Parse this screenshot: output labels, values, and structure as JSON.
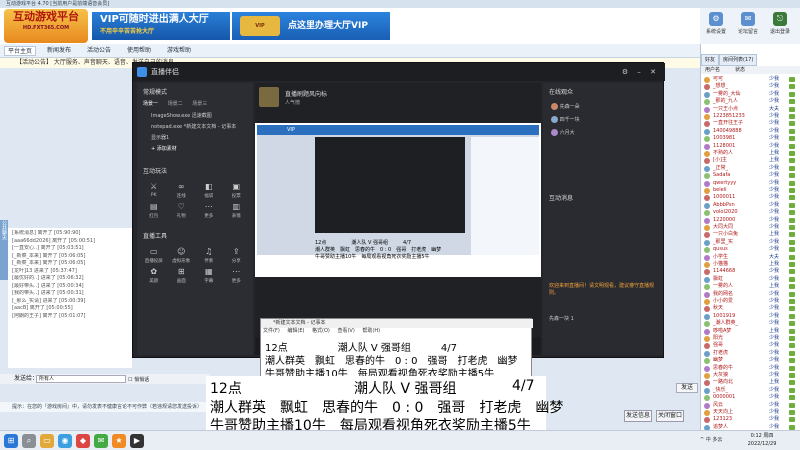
{
  "titlebar": {
    "text": "互动游戏平台 4.70 [当前用户是前端语音会员]"
  },
  "logo": {
    "main": "互动游戏平台",
    "sub": "HD.FXT365.COM"
  },
  "ads": [
    {
      "title": "VIP可随时进出满人大厅",
      "sub": "不用辛辛苦苦抢大厅"
    },
    {
      "title": "点这里办理大厅VIP"
    }
  ],
  "navbar": {
    "items": [
      "平台主页",
      "新闻发布",
      "活动公告",
      "使用帮助",
      "游戏帮助"
    ]
  },
  "right_toolbar": {
    "items": [
      {
        "label": "系统设置",
        "icon": "gear-icon"
      },
      {
        "label": "论坛留言",
        "icon": "chat-icon"
      },
      {
        "label": "退出登录",
        "icon": "logout-icon"
      }
    ]
  },
  "notice": {
    "text": "【活动公告】 大厅服务、声音聊天、语音、发送自己的消息..."
  },
  "chatlog": [
    "[系统消息] 离开了 [05:90:90]",
    "[aaa66dd2026] 离开了 [05:00:51]",
    "[一直安心..] 离开了 [05:03:51]",
    "[_新菜_本来] 离开了 [05:06:05]",
    "[_新菜_本来] 离开了 [05:06:05]",
    "[龙叶]13 进来了 [05:37:47]",
    "[最优好的..] 进来了 [05:06:32]",
    "[最好带头..] 进来了 [05:00:34]",
    "[我的带头..] 进来了 [05:00:31]",
    "[_那么_实请] 进来了 [05:00:39]",
    "[aacB] 离开了 [05:00:55]",
    "[阿朗的王子] 离开了 [05:01:07]"
  ],
  "input": {
    "label": "发送给：",
    "value": "所有人",
    "checkbox": "悄悄话"
  },
  "bottom_tip": "提示：在您的『游戏房间』中，请勿发表不健康言论不可作弊（若违规请您发送投诉）",
  "buttons": {
    "send": "发送",
    "confirm": "发送信息",
    "close": "关闭窗口"
  },
  "obs": {
    "title": "直播伴侣",
    "scene_header": "常规模式",
    "scene_tabs": [
      "场景一",
      "场景二",
      "场景三"
    ],
    "sources": [
      "ImageShow.exe 迅速截图",
      "notepad.exe *新建文本文档 - 记事本",
      "显示器1"
    ],
    "add_source": "+ 添加素材",
    "interact_header": "互动玩法",
    "interact_tools": [
      "PK",
      "连线",
      "福袋",
      "投票",
      "红包",
      "礼物",
      "更多",
      "表情"
    ],
    "live_tools_header": "直播工具",
    "live_tools": [
      "直播投屏",
      "虚拟形象",
      "伴奏",
      "分享",
      "美颜",
      "画面",
      "字幕",
      "更多"
    ],
    "stream_name": "直播刷题风向标",
    "viewers_label": "人气榜",
    "audience_header": "在线观众",
    "audience": [
      "先森一朵",
      "四千一块",
      "六月大"
    ],
    "comments_header": "互动消息",
    "chat_tip": "欢迎来到直播间！请文明观看，建议遵守直播规则。",
    "gift_item": "先森一块 1"
  },
  "preview": {
    "line1": "12点　　　　　潮人队 V 强哥组　　　4/7",
    "line2": "潮人群英　飘虹　思春的牛　0 : 0　强哥　打老虎　幽梦",
    "line3": "牛哥赞助主播10牛　每局观看视角死衣奖励主播5牛"
  },
  "notepad": {
    "title": "*新建文本文档 - 记事本",
    "menu": [
      "文件(F)",
      "编辑(E)",
      "格式(O)",
      "查看(V)",
      "帮助(H)"
    ],
    "line1": "12点　　　　　潮人队 V 强哥组　　　4/7",
    "line2": "潮人群英　飘虹　思春的牛　0 : 0　强哥　打老虎　幽梦",
    "line3": "牛哥赞助主播10牛　每局观看视角死衣奖励主播5牛"
  },
  "overlay": {
    "row1": [
      {
        "text": "12点"
      },
      {
        "text": "潮人队 V 强哥组"
      },
      {
        "text": "4/7"
      }
    ],
    "line2": "潮人群英　飘虹　思春的牛　0 : 0　强哥　打老虎　幽梦",
    "line3": "牛哥赞助主播10牛　每局观看视角死衣奖励主播5牛"
  },
  "userpanel": {
    "tabs": [
      "好友",
      "房间列表(17)"
    ],
    "header": "用户名　　　状态",
    "users": [
      {
        "name": "可可",
        "status": "少我"
      },
      {
        "name": "_想想_",
        "status": "少我"
      },
      {
        "name": "一雾的_大仙",
        "status": "少我"
      },
      {
        "name": "_那的_九人",
        "status": "少我"
      },
      {
        "name": "一只王小点",
        "status": "大夫"
      },
      {
        "name": "1223851233",
        "status": "少我"
      },
      {
        "name": "一直开往王子",
        "status": "少我"
      },
      {
        "name": "140049888",
        "status": "少我"
      },
      {
        "name": "1003981",
        "status": "少我"
      },
      {
        "name": "1128001",
        "status": "少我"
      },
      {
        "name": "不熟的人",
        "status": "上我"
      },
      {
        "name": "[小]主",
        "status": "上我"
      },
      {
        "name": "_正常_",
        "status": "少我"
      },
      {
        "name": "Sadafa",
        "status": "少我"
      },
      {
        "name": "qwertyyy",
        "status": "少我"
      },
      {
        "name": "beleli",
        "status": "少我"
      },
      {
        "name": "1000011",
        "status": "少我"
      },
      {
        "name": "AbbbPsn",
        "status": "少我"
      },
      {
        "name": "volol2020",
        "status": "少我"
      },
      {
        "name": "1220000",
        "status": "少我"
      },
      {
        "name": "大同大同",
        "status": "少我"
      },
      {
        "name": "一只小白兔",
        "status": "上我"
      },
      {
        "name": "_那里_实",
        "status": "少我"
      },
      {
        "name": "qusus",
        "status": "少我"
      },
      {
        "name": "小学生",
        "status": "大夫"
      },
      {
        "name": "小猫猫",
        "status": "上我"
      },
      {
        "name": "1144668",
        "status": "少我"
      },
      {
        "name": "飘虹",
        "status": "少我"
      },
      {
        "name": "一雾的人",
        "status": "上我"
      },
      {
        "name": "我的网名",
        "status": "少我"
      },
      {
        "name": "小小的爱",
        "status": "少我"
      },
      {
        "name": "秋天",
        "status": "少我"
      },
      {
        "name": "1001919",
        "status": "少我"
      },
      {
        "name": "_潮人群英_",
        "status": "少我"
      },
      {
        "name": "哆啦A梦",
        "status": "上我"
      },
      {
        "name": "阳光",
        "status": "少我"
      },
      {
        "name": "强哥",
        "status": "少我"
      },
      {
        "name": "打老虎",
        "status": "少我"
      },
      {
        "name": "幽梦",
        "status": "少我"
      },
      {
        "name": "思春的牛",
        "status": "少我"
      },
      {
        "name": "大灰狼",
        "status": "少我"
      },
      {
        "name": "一路向北",
        "status": "上我"
      },
      {
        "name": "_快乐_",
        "status": "少我"
      },
      {
        "name": "0000001",
        "status": "少我"
      },
      {
        "name": "风云",
        "status": "少我"
      },
      {
        "name": "天天向上",
        "status": "少我"
      },
      {
        "name": "123123",
        "status": "少我"
      },
      {
        "name": "追梦人",
        "status": "少我"
      },
      {
        "name": "老王",
        "status": "少我"
      }
    ]
  },
  "taskbar": {
    "time": "0:12 周四",
    "date": "2022/12/29",
    "tray": "^ 中 多云"
  },
  "colors": {
    "accent": "#3d8fe8",
    "obs_bg": "#25262b",
    "user_name": "#b01818"
  }
}
